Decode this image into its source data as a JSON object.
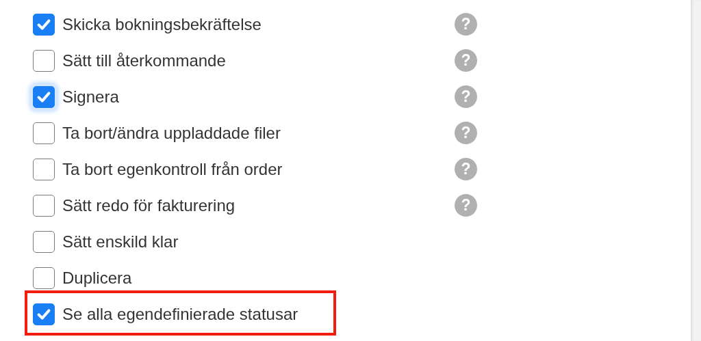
{
  "items": [
    {
      "label": "Skicka bokningsbekräftelse",
      "checked": true,
      "focused": false,
      "highlighted": false,
      "help": "?"
    },
    {
      "label": "Sätt till återkommande",
      "checked": false,
      "focused": false,
      "highlighted": false,
      "help": "?"
    },
    {
      "label": "Signera",
      "checked": true,
      "focused": true,
      "highlighted": false,
      "help": "?"
    },
    {
      "label": "Ta bort/ändra uppladdade filer",
      "checked": false,
      "focused": false,
      "highlighted": false,
      "help": "?"
    },
    {
      "label": "Ta bort egenkontroll från order",
      "checked": false,
      "focused": false,
      "highlighted": false,
      "help": "?"
    },
    {
      "label": "Sätt redo för fakturering",
      "checked": false,
      "focused": false,
      "highlighted": false,
      "help": "?"
    },
    {
      "label": "Sätt enskild klar",
      "checked": false,
      "focused": false,
      "highlighted": false
    },
    {
      "label": "Duplicera",
      "checked": false,
      "focused": false,
      "highlighted": false
    },
    {
      "label": "Se alla egendefinierade statusar",
      "checked": true,
      "focused": false,
      "highlighted": true
    }
  ]
}
